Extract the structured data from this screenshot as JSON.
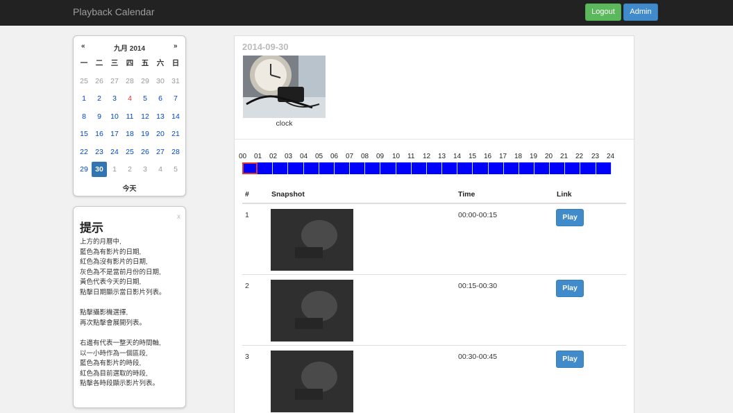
{
  "navbar": {
    "brand": "Playback Calendar",
    "logout_label": "Logout",
    "admin_label": "Admin"
  },
  "calendar": {
    "prev": "«",
    "next": "»",
    "title": "九月 2014",
    "weekdays": [
      "一",
      "二",
      "三",
      "四",
      "五",
      "六",
      "日"
    ],
    "weeks": [
      [
        "25",
        "26",
        "27",
        "28",
        "29",
        "30",
        "31"
      ],
      [
        "1",
        "2",
        "3",
        "4",
        "5",
        "6",
        "7"
      ],
      [
        "8",
        "9",
        "10",
        "11",
        "12",
        "13",
        "14"
      ],
      [
        "15",
        "16",
        "17",
        "18",
        "19",
        "20",
        "21"
      ],
      [
        "22",
        "23",
        "24",
        "25",
        "26",
        "27",
        "28"
      ],
      [
        "29",
        "30",
        "1",
        "2",
        "3",
        "4",
        "5"
      ]
    ],
    "today_label": "今天"
  },
  "hint": {
    "close": "x",
    "title": "提示",
    "body": "上方的月曆中,\n藍色為有影片的日期,\n紅色為沒有影片的日期,\n灰色為不是當前月份的日期,\n黃色代表今天的日期,\n點擊日期顯示當日影片列表。\n\n點擊攝影機選擇,\n再次點擊會展開列表。\n\n右邊有代表一整天的時間軸,\n以一小時作為一個區段,\n藍色為有影片的時段,\n紅色為目前選取的時段,\n點擊各時段顯示影片列表。"
  },
  "main": {
    "date": "2014-09-30",
    "camera_label": "clock",
    "hours": [
      "00",
      "01",
      "02",
      "03",
      "04",
      "05",
      "06",
      "07",
      "08",
      "09",
      "10",
      "11",
      "12",
      "13",
      "14",
      "15",
      "16",
      "17",
      "18",
      "19",
      "20",
      "21",
      "22",
      "23",
      "24"
    ],
    "table": {
      "headers": {
        "num": "#",
        "snapshot": "Snapshot",
        "time": "Time",
        "link": "Link"
      },
      "rows": [
        {
          "num": "1",
          "time": "00:00-00:15",
          "action": "Play"
        },
        {
          "num": "2",
          "time": "00:15-00:30",
          "action": "Play"
        },
        {
          "num": "3",
          "time": "00:30-00:45",
          "action": "Play"
        }
      ]
    }
  },
  "colors": {
    "navbar": "#222222",
    "logout": "#5cb85c",
    "primary": "#428bca",
    "timeline": "#0000ff",
    "selected_segment": "#e23b2e",
    "available_date": "#0044cc",
    "no_video_date": "#e9322d"
  }
}
